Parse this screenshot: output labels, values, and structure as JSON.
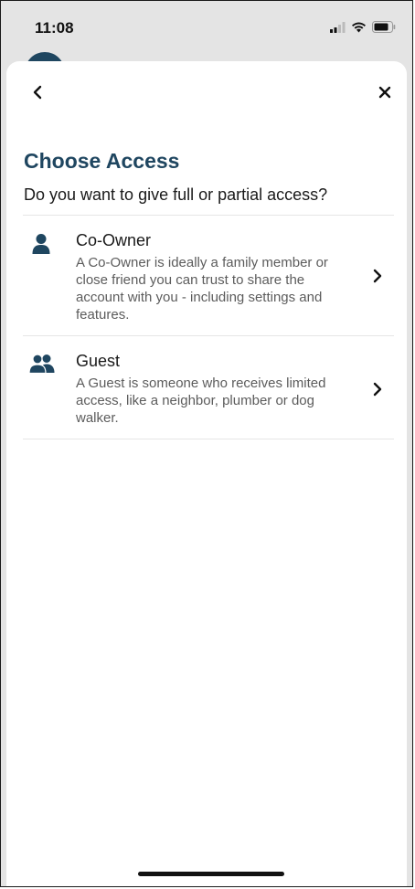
{
  "status_bar": {
    "time": "11:08",
    "icons": [
      "signal-icon",
      "wifi-icon",
      "battery-icon"
    ]
  },
  "nav": {
    "back_icon": "chevron-left-icon",
    "close_icon": "close-icon"
  },
  "page": {
    "title": "Choose Access",
    "subtitle": "Do you want to give full or partial access?"
  },
  "options": [
    {
      "icon": "person-icon",
      "title": "Co-Owner",
      "description": "A Co-Owner is ideally a family member or close friend you can trust to share the account with you - including settings and features."
    },
    {
      "icon": "people-icon",
      "title": "Guest",
      "description": "A Guest is someone who receives limited access, like a neighbor, plumber or dog walker."
    }
  ],
  "colors": {
    "brand": "#1f4660",
    "text": "#1a1a1a",
    "muted": "#5c5c5c",
    "divider": "#e6e6e6"
  }
}
